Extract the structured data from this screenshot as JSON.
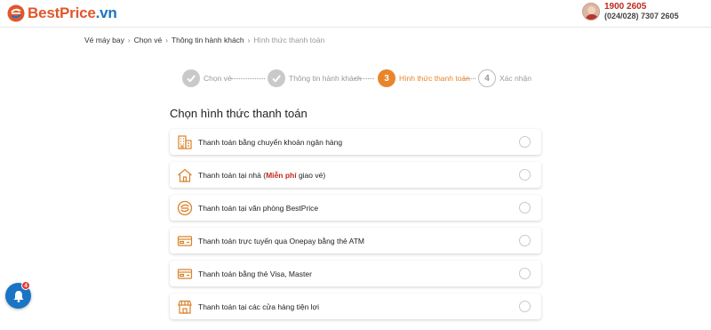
{
  "header": {
    "logo_text": "BestPrice",
    "logo_suffix": ".vn",
    "hotline_main": "1900 2605",
    "hotline_sub": "(024/028) 7307 2605"
  },
  "breadcrumb": {
    "items": [
      "Vé máy bay",
      "Chọn vé",
      "Thông tin hành khách",
      "Hình thức thanh toán"
    ],
    "separator": "›"
  },
  "steps": [
    {
      "label": "Chọn vé",
      "state": "done",
      "number": ""
    },
    {
      "label": "Thông tin hành khách",
      "state": "done",
      "number": ""
    },
    {
      "label": "Hình thức thanh toán",
      "state": "active",
      "number": "3"
    },
    {
      "label": "Xác nhận",
      "state": "todo",
      "number": "4"
    }
  ],
  "section_title": "Chọn hình thức thanh toán",
  "payment_options": [
    {
      "label": "Thanh toán bằng chuyển khoản ngân hàng",
      "icon": "bank-building-icon"
    },
    {
      "label_before": "Thanh toán tại nhà (",
      "label_highlight": "Miễn phí",
      "label_after": " giao vé)",
      "icon": "home-icon"
    },
    {
      "label": "Thanh toán tại văn phòng BestPrice",
      "icon": "bestprice-office-icon"
    },
    {
      "label": "Thanh toán trực tuyến qua Onepay bằng thẻ ATM",
      "icon": "atm-card-icon"
    },
    {
      "label": "Thanh toán bằng thẻ Visa, Master",
      "icon": "credit-card-icon"
    },
    {
      "label": "Thanh toán tại các cửa hàng tiện lợi",
      "icon": "convenience-store-icon"
    }
  ],
  "notifications": {
    "badge_count": "4"
  },
  "colors": {
    "brand_orange": "#e2562a",
    "brand_blue": "#1a74c4",
    "active_step": "#e8852b",
    "icon_orange": "#d9822b",
    "hotline_red": "#c0291f"
  }
}
